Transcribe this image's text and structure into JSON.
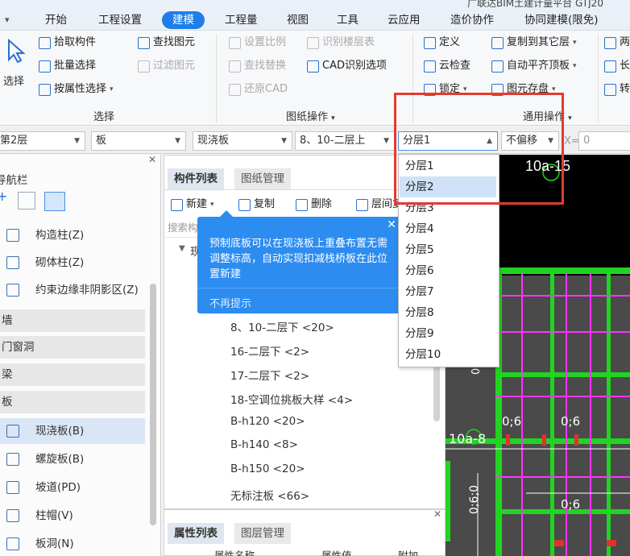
{
  "menu": {
    "items": [
      "开始",
      "工程设置",
      "建模",
      "工程量",
      "视图",
      "工具",
      "云应用",
      "造价协作",
      "协同建模(限免)"
    ],
    "active": "建模",
    "title_fragment": "广联达BIM土建计量平台 GTJ20"
  },
  "ribbon": {
    "select_label": "选择",
    "pick_component": "拾取构件",
    "batch_select": "批量选择",
    "select_by_attr": "按属性选择",
    "find_element": "查找图元",
    "filter_element": "过滤图元",
    "group_select": "选择",
    "set_scale": "设置比例",
    "recognize_floor_table": "识别楼层表",
    "find_replace": "查找替换",
    "cad_recognize_options": "CAD识别选项",
    "restore_cad": "还原CAD",
    "group_drawing_ops": "图纸操作",
    "define": "定义",
    "copy_to_other_floor": "复制到其它层",
    "cloud_check": "云检查",
    "auto_flush_top_slab": "自动平齐顶板",
    "lock": "锁定",
    "element_save": "图元存盘",
    "group_common_ops": "通用操作",
    "right_cut_1": "两",
    "right_cut_2": "长",
    "right_cut_3": "转"
  },
  "toolbar": {
    "floor": "第2层",
    "category": "板",
    "type": "现浇板",
    "component": "8、10-二层上",
    "layer": "分层1",
    "offset": "不偏移",
    "x_label": "X=",
    "x_value": "0"
  },
  "dropdown": {
    "items": [
      "分层1",
      "分层2",
      "分层3",
      "分层4",
      "分层5",
      "分层6",
      "分层7",
      "分层8",
      "分层9",
      "分层10"
    ],
    "highlighted": "分层2"
  },
  "leftnav": {
    "header": "导航栏",
    "items": [
      {
        "label": "构造柱(Z)"
      },
      {
        "label": "砌体柱(Z)"
      },
      {
        "label": "约束边缘非阴影区(Z)"
      }
    ],
    "cats": [
      "墙",
      "门窗洞",
      "梁",
      "板"
    ],
    "plate_items": [
      {
        "label": "现浇板(B)"
      },
      {
        "label": "螺旋板(B)"
      },
      {
        "label": "坡道(PD)"
      },
      {
        "label": "柱帽(V)"
      },
      {
        "label": "板洞(N)"
      }
    ]
  },
  "complist": {
    "tab_components": "构件列表",
    "tab_drawings": "图纸管理",
    "new_btn": "新建",
    "copy_btn": "复制",
    "delete_btn": "删除",
    "layer_btn": "层间复制",
    "search_placeholder": "搜索构件...",
    "tree_root": "现浇板",
    "items": [
      "8、10-二层下 <20>",
      "16-二层下 <2>",
      "17-二层下 <2>",
      "18-空调位挑板大样 <4>",
      "B-h120 <20>",
      "B-h140 <8>",
      "B-h150 <20>",
      "无标注板 <66>"
    ]
  },
  "tooltip": {
    "text": "预制底板可以在现浇板上重叠布置无需调整标高，自动实现扣减栈桥板在此位置新建",
    "no_more": "不再提示"
  },
  "props": {
    "tab_props": "属性列表",
    "tab_layers": "图层管理",
    "col_name": "属性名称",
    "col_value": "属性值",
    "col_extra": "附加"
  },
  "cad": {
    "label_top": "10a-15",
    "label_mid": "10a-8",
    "label_06a": "0;6",
    "label_06b": "0;6",
    "label_06c": "0;6",
    "label_06d": "0;6",
    "label_vert": "0;6;0"
  }
}
